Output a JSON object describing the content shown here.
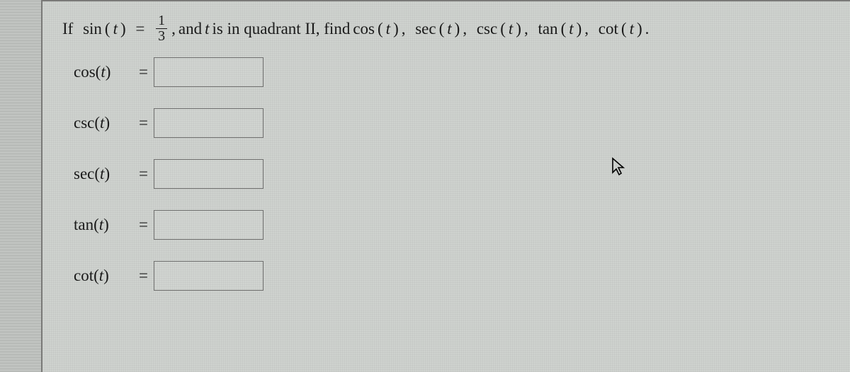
{
  "prompt": {
    "if_word": "If",
    "sin_label": "sin",
    "lparen": "(",
    "var_t": "t",
    "rparen": ")",
    "eq": "=",
    "frac_num": "1",
    "frac_den": "3",
    "comma": ",",
    "mid_text_1": " and ",
    "mid_text_2": " is in quadrant II, find ",
    "cos_label": "cos",
    "sec_label": "sec",
    "csc_label": "csc",
    "tan_label": "tan",
    "cot_label": "cot",
    "period": "."
  },
  "rows": {
    "cos": {
      "label": "cos",
      "value": ""
    },
    "csc": {
      "label": "csc",
      "value": ""
    },
    "sec": {
      "label": "sec",
      "value": ""
    },
    "tan": {
      "label": "tan",
      "value": ""
    },
    "cot": {
      "label": "cot",
      "value": ""
    }
  }
}
